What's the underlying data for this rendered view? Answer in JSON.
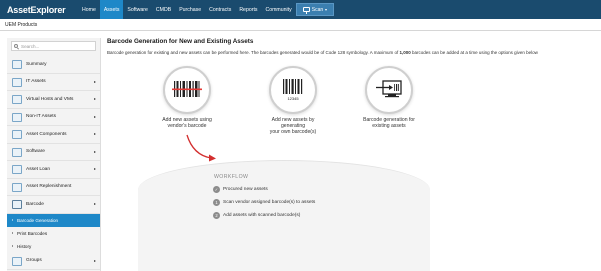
{
  "app": {
    "logo": "AssetExplorer"
  },
  "nav": {
    "items": [
      "Home",
      "Assets",
      "Software",
      "CMDB",
      "Purchase",
      "Contracts",
      "Reports",
      "Community"
    ],
    "active": "Assets",
    "scan_label": "Scan"
  },
  "subheader": {
    "title": "UEM Products"
  },
  "sidebar": {
    "search_placeholder": "Search...",
    "items": [
      {
        "label": "Summary",
        "icon": "summary-icon",
        "has_arrow": false
      },
      {
        "label": "IT Assets",
        "icon": "it-assets-icon",
        "has_arrow": true
      },
      {
        "label": "Virtual Hosts and VMs",
        "icon": "virtual-hosts-icon",
        "has_arrow": true
      },
      {
        "label": "Non-IT Assets",
        "icon": "non-it-assets-icon",
        "has_arrow": true
      },
      {
        "label": "Asset Components",
        "icon": "asset-components-icon",
        "has_arrow": true
      },
      {
        "label": "Software",
        "icon": "software-icon",
        "has_arrow": true
      },
      {
        "label": "Asset Loan",
        "icon": "asset-loan-icon",
        "has_arrow": true
      },
      {
        "label": "Asset Replenishment",
        "icon": "asset-replenishment-icon",
        "has_arrow": false
      },
      {
        "label": "Barcode",
        "icon": "barcode-icon",
        "has_arrow": true
      }
    ],
    "subitems": [
      {
        "label": "Barcode Generation",
        "active": true
      },
      {
        "label": "Print Barcodes",
        "active": false
      },
      {
        "label": "History",
        "active": false
      }
    ],
    "groups_label": "Groups"
  },
  "main": {
    "title": "Barcode Generation for New and Existing Assets",
    "desc_before": "Barcode generation for existing and new assets can be performed here. The barcodes generated would be of Code 128 symbology. A maximum of ",
    "desc_bold": "1,000",
    "desc_after": " barcodes can be added at a time using the options given below",
    "options": [
      {
        "line1": "Add new assets using",
        "line2": "vendor's barcode",
        "line3": "",
        "icon": "barcode-scan-icon"
      },
      {
        "line1": "Add new assets by",
        "line2": "generating",
        "line3": "your own barcode(s)",
        "icon": "barcode-generate-icon"
      },
      {
        "line1": "Barcode generation for",
        "line2": "existing assets",
        "line3": "",
        "icon": "existing-assets-icon"
      }
    ],
    "barcode_number": "12345",
    "workflow": {
      "title": "WORKFLOW",
      "steps": [
        {
          "num": "✓",
          "text": "Procured new assets"
        },
        {
          "num": "1",
          "text": "Scan vendor assigned barcode(s) to assets"
        },
        {
          "num": "2",
          "text": "Add assets with scanned barcode(s)"
        }
      ]
    }
  },
  "colors": {
    "topbar": "#1a4b6e",
    "active_nav": "#1e88c8",
    "sidebar_active": "#1e88c8",
    "arrow": "#d32f2f"
  }
}
